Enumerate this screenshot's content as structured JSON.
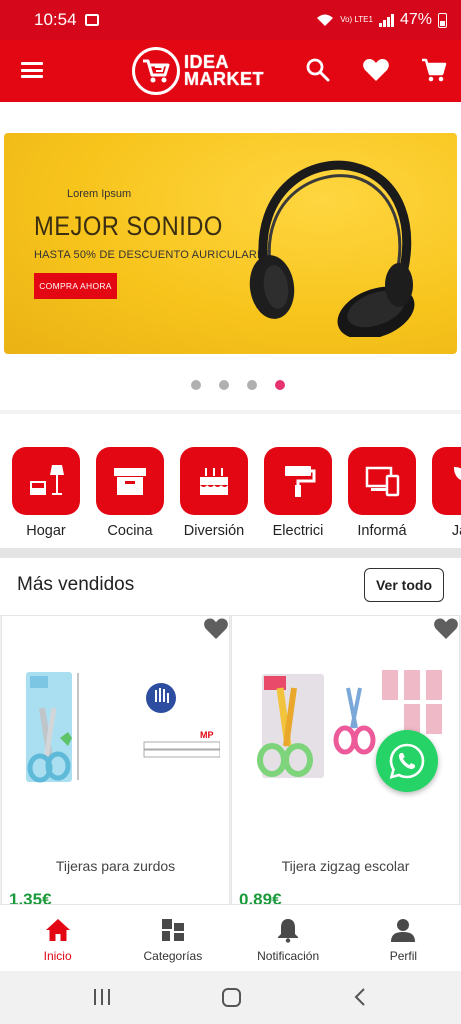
{
  "status": {
    "time": "10:54",
    "battery": "47%",
    "network": "Vo) LTE1"
  },
  "header": {
    "brand_line1": "IDEA",
    "brand_line2": "MARKET"
  },
  "banner": {
    "small": "Lorem Ipsum",
    "title": "MEJOR SONIDO",
    "subtitle": "HASTA 50% DE DESCUENTO AURICULARES",
    "button": "COMPRA AHORA",
    "slides": 4,
    "active_slide": 4
  },
  "categories": [
    {
      "label": "Hogar",
      "icon": "home-furniture-icon"
    },
    {
      "label": "Cocina",
      "icon": "box-icon"
    },
    {
      "label": "Diversión",
      "icon": "cake-icon"
    },
    {
      "label": "Electrici",
      "icon": "paint-roller-icon"
    },
    {
      "label": "Informá",
      "icon": "devices-icon"
    },
    {
      "label": "Jard",
      "icon": "garden-icon"
    }
  ],
  "bestsellers": {
    "title": "Más vendidos",
    "see_all": "Ver todo",
    "products": [
      {
        "name": "Tijeras para zurdos",
        "price": "1,35€"
      },
      {
        "name": "Tijera zigzag escolar",
        "price": "0,89€"
      }
    ]
  },
  "bottom_nav": [
    {
      "label": "Inicio",
      "active": true
    },
    {
      "label": "Categorías",
      "active": false
    },
    {
      "label": "Notificación",
      "active": false
    },
    {
      "label": "Perfil",
      "active": false
    }
  ],
  "colors": {
    "brand_red": "#e30613",
    "banner_yellow": "#f7c41c",
    "price_green": "#1a9a3a",
    "dot_active": "#e8336e"
  }
}
